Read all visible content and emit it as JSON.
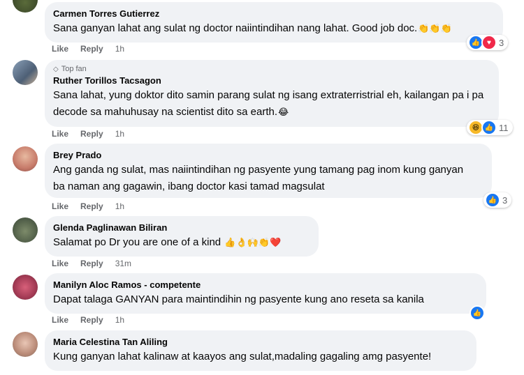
{
  "labels": {
    "like": "Like",
    "reply": "Reply"
  },
  "comments": [
    {
      "author": "Carmen Torres Gutierrez",
      "badge": "",
      "text": "Sana ganyan lahat ang sulat ng doctor naiintindihan nang lahat. Good job doc.",
      "trailing_emoji": [
        "👏",
        "👏",
        "👏"
      ],
      "time": "1h",
      "reactions": {
        "icons": [
          "like-icon",
          "love-icon"
        ],
        "count": "3"
      }
    },
    {
      "author": "Ruther Torillos Tacsagon",
      "badge": "Top fan",
      "text": "Sana lahat, yung doktor dito samin parang sulat ng isang extraterristrial eh, kailangan pa i pa decode sa mahuhusay na scientist dito sa earth.",
      "trailing_emoji": [
        "😂"
      ],
      "time": "1h",
      "reactions": {
        "icons": [
          "haha-icon",
          "like-icon"
        ],
        "count": "11"
      }
    },
    {
      "author": "Brey Prado",
      "badge": "",
      "text": "Ang ganda ng sulat, mas naiintindihan ng pasyente yung tamang pag inom kung ganyan ba naman ang gagawin, ibang doctor kasi tamad magsulat",
      "trailing_emoji": [],
      "time": "1h",
      "reactions": {
        "icons": [
          "like-icon"
        ],
        "count": "3"
      }
    },
    {
      "author": "Glenda Paglinawan Biliran",
      "badge": "",
      "text": "Salamat po Dr you are one of a kind",
      "trailing_emoji": [
        "👍",
        "👌",
        "🙌",
        "👏",
        "❤️"
      ],
      "time": "31m",
      "reactions": null
    },
    {
      "author": "Manilyn Aloc Ramos - competente",
      "badge": "",
      "text": "Dapat talaga GANYAN para maintindihin ng pasyente kung ano reseta sa kanila",
      "trailing_emoji": [],
      "time": "1h",
      "reactions": {
        "icons": [
          "like-icon"
        ],
        "count": ""
      }
    },
    {
      "author": "Maria Celestina Tan Aliling",
      "badge": "",
      "text": "Kung ganyan lahat kalinaw at kaayos ang sulat,madaling gagaling amg pasyente!",
      "trailing_emoji": [],
      "time": "",
      "reactions": null
    }
  ]
}
